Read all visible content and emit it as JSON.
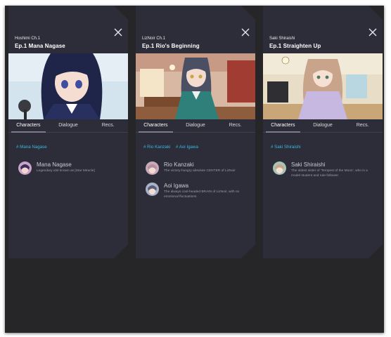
{
  "cards": [
    {
      "subtitle": "Hoshimi Ch.1",
      "title": "Ep.1 Mana Nagase",
      "tabs": [
        "Characters",
        "Dialogue",
        "Recs."
      ],
      "tags": [
        "# Mana Nagase"
      ],
      "characters": [
        {
          "name": "Mana Nagase",
          "desc": "Legendary idol known as [Star Miracle]"
        }
      ]
    },
    {
      "subtitle": "LizNoir Ch.1",
      "title": "Ep.1 Rio's Beginning",
      "tabs": [
        "Characters",
        "Dialogue",
        "Recs."
      ],
      "tags": [
        "# Rio Kanzaki",
        "# Aoi Igawa"
      ],
      "characters": [
        {
          "name": "Rio Kanzaki",
          "desc": "The victory-hungry absolute CENTER of LizNoir"
        },
        {
          "name": "Aoi Igawa",
          "desc": "The always cool-headed BRAIN of LizNoir, with no emotional fluctuations"
        }
      ]
    },
    {
      "subtitle": "Saki Shiraishi",
      "title": "Ep.1 Straighten Up",
      "tabs": [
        "Characters",
        "Dialogue",
        "Recs."
      ],
      "tags": [
        "# Saki Shiraishi"
      ],
      "characters": [
        {
          "name": "Saki Shiraishi",
          "desc": "The oldest sister of 'Tempest of the Moon', who is a model student and rule-follower."
        }
      ]
    }
  ],
  "colors": {
    "panel": "#2c2d38",
    "tag": "#3ab8e0",
    "backdrop": "#262629"
  },
  "icons": {
    "close": "close-icon"
  }
}
